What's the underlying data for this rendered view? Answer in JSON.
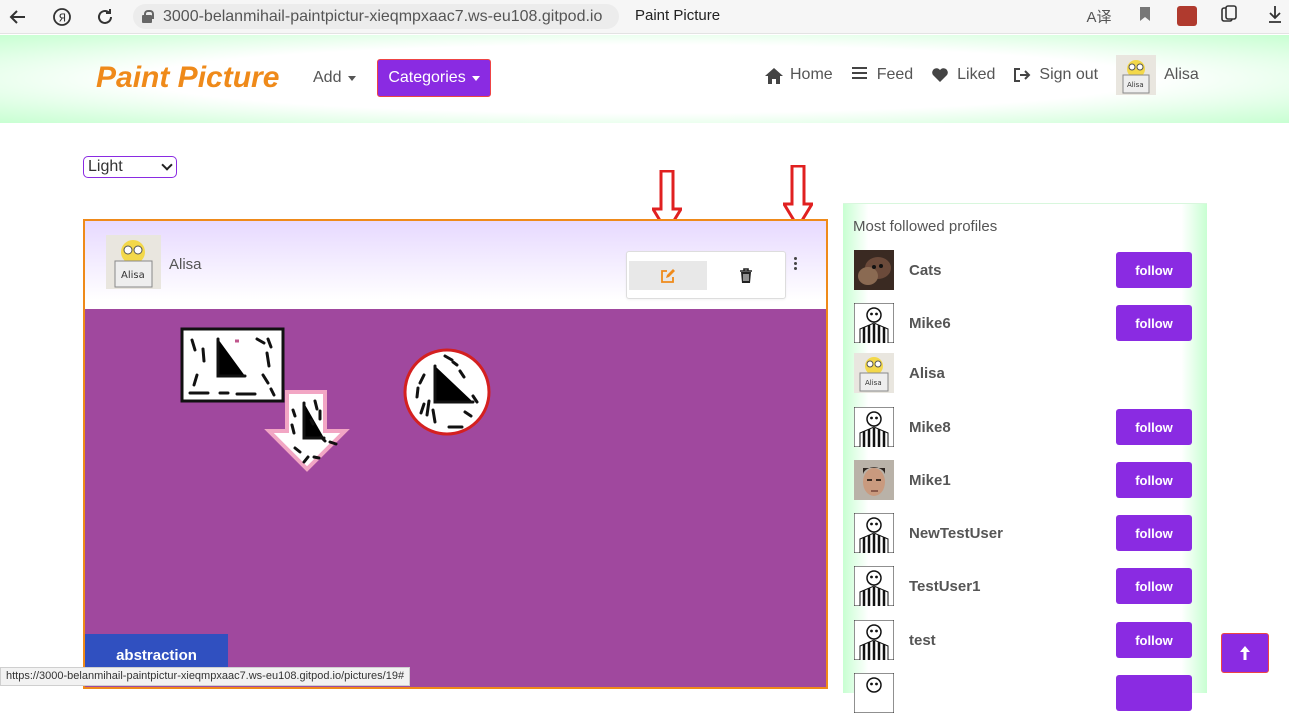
{
  "browser": {
    "url": "3000-belanmihail-paintpictur-xieqmpxaac7.ws-eu108.gitpod.io",
    "tab_title": "Paint Picture",
    "status_url": "https://3000-belanmihail-paintpictur-xieqmpxaac7.ws-eu108.gitpod.io/pictures/19#"
  },
  "navbar": {
    "brand": "Paint Picture",
    "add_label": "Add",
    "categories_label": "Categories",
    "links": [
      {
        "label": "Home",
        "icon": "home-icon"
      },
      {
        "label": "Feed",
        "icon": "list-icon"
      },
      {
        "label": "Liked",
        "icon": "heart-icon"
      },
      {
        "label": "Sign out",
        "icon": "sign-out-icon"
      }
    ],
    "username": "Alisa"
  },
  "theme_select": {
    "value": "Light"
  },
  "post": {
    "author": "Alisa",
    "tag": "abstraction",
    "canvas_color": "#a0489e"
  },
  "sidebar": {
    "title": "Most followed profiles",
    "follow_label": "follow",
    "profiles": [
      {
        "name": "Cats",
        "avatar": "cat-photo",
        "follow": true
      },
      {
        "name": "Mike6",
        "avatar": "striped-shirt-avatar",
        "follow": true
      },
      {
        "name": "Alisa",
        "avatar": "minion-avatar",
        "follow": false
      },
      {
        "name": "Mike8",
        "avatar": "striped-shirt-avatar",
        "follow": true
      },
      {
        "name": "Mike1",
        "avatar": "face-photo",
        "follow": true
      },
      {
        "name": "NewTestUser",
        "avatar": "striped-shirt-avatar",
        "follow": true
      },
      {
        "name": "TestUser1",
        "avatar": "striped-shirt-avatar",
        "follow": true
      },
      {
        "name": "test",
        "avatar": "striped-shirt-avatar",
        "follow": true
      }
    ]
  },
  "colors": {
    "accent": "#8a2be2",
    "brand": "#ef8a1a",
    "tag": "#3050c0",
    "arrow": "#e02020"
  }
}
